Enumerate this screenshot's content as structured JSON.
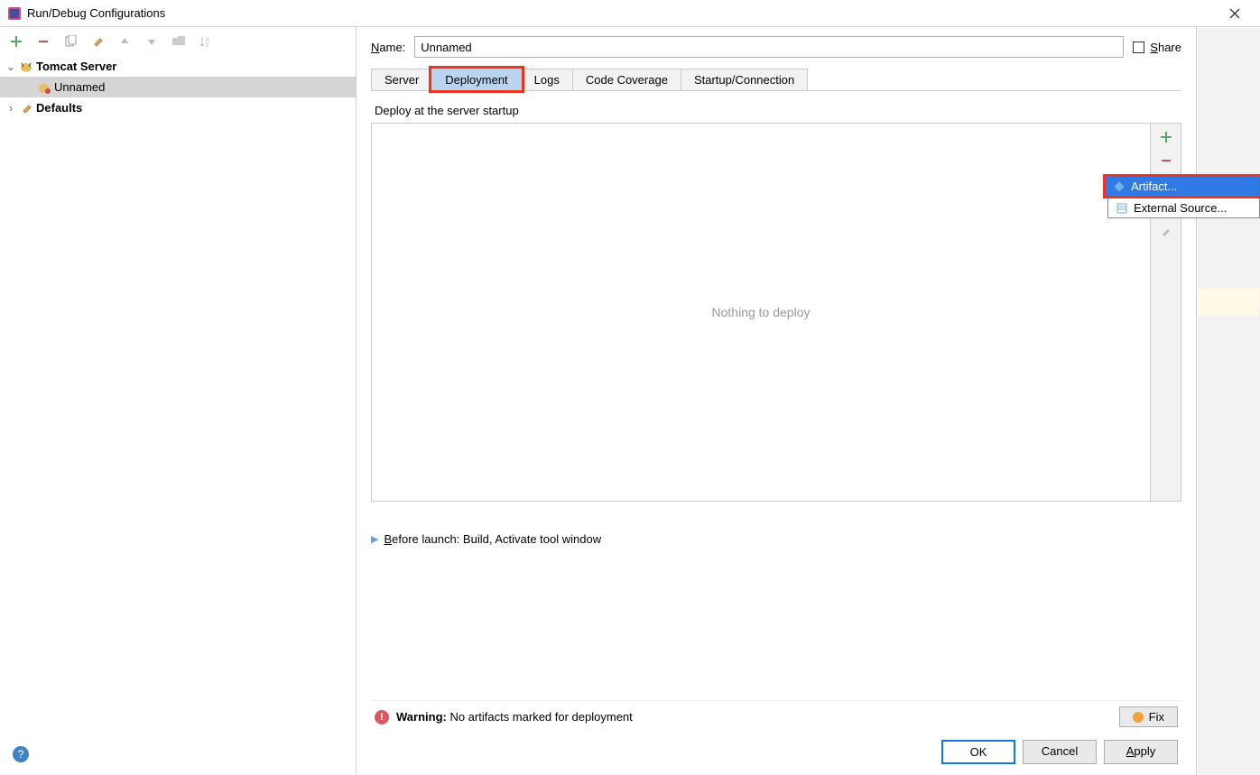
{
  "titlebar": {
    "title": "Run/Debug Configurations"
  },
  "name": {
    "label": "Name:",
    "value": "Unnamed"
  },
  "share": {
    "label": "Share"
  },
  "tree": {
    "tomcat": "Tomcat Server",
    "unnamed": "Unnamed",
    "defaults": "Defaults"
  },
  "tabs": {
    "server": "Server",
    "deployment": "Deployment",
    "logs": "Logs",
    "coverage": "Code Coverage",
    "startup": "Startup/Connection"
  },
  "deploy": {
    "section": "Deploy at the server startup",
    "placeholder": "Nothing to deploy"
  },
  "before_launch": "Before launch: Build, Activate tool window",
  "warning": {
    "label": "Warning:",
    "text": " No artifacts marked for deployment",
    "fix": "Fix"
  },
  "menu": {
    "artifact": "Artifact...",
    "external": "External Source..."
  },
  "buttons": {
    "ok": "OK",
    "cancel": "Cancel",
    "apply": "Apply"
  }
}
